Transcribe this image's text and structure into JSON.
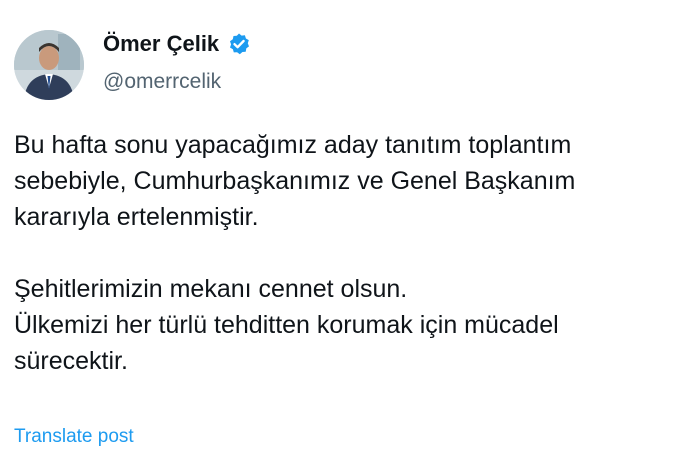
{
  "author": {
    "name": "Ömer Çelik",
    "handle": "@omerrcelik",
    "verified": true,
    "avatar_icon": "profile-photo",
    "badge_icon": "verified-badge-icon",
    "badge_color": "#1d9bf0"
  },
  "post": {
    "paragraph1": [
      "Bu hafta sonu yapacağımız aday tanıtım toplantım",
      "sebebiyle, Cumhurbaşkanımız ve Genel Başkanım",
      "kararıyla ertelenmiştir."
    ],
    "paragraph2": [
      "Şehitlerimizin mekanı cennet olsun.",
      "Ülkemizi her türlü tehditten korumak için mücadel",
      "sürecektir."
    ]
  },
  "actions": {
    "translate_label": "Translate post"
  },
  "colors": {
    "text": "#0f1419",
    "secondary": "#536471",
    "link": "#1d9bf0"
  }
}
